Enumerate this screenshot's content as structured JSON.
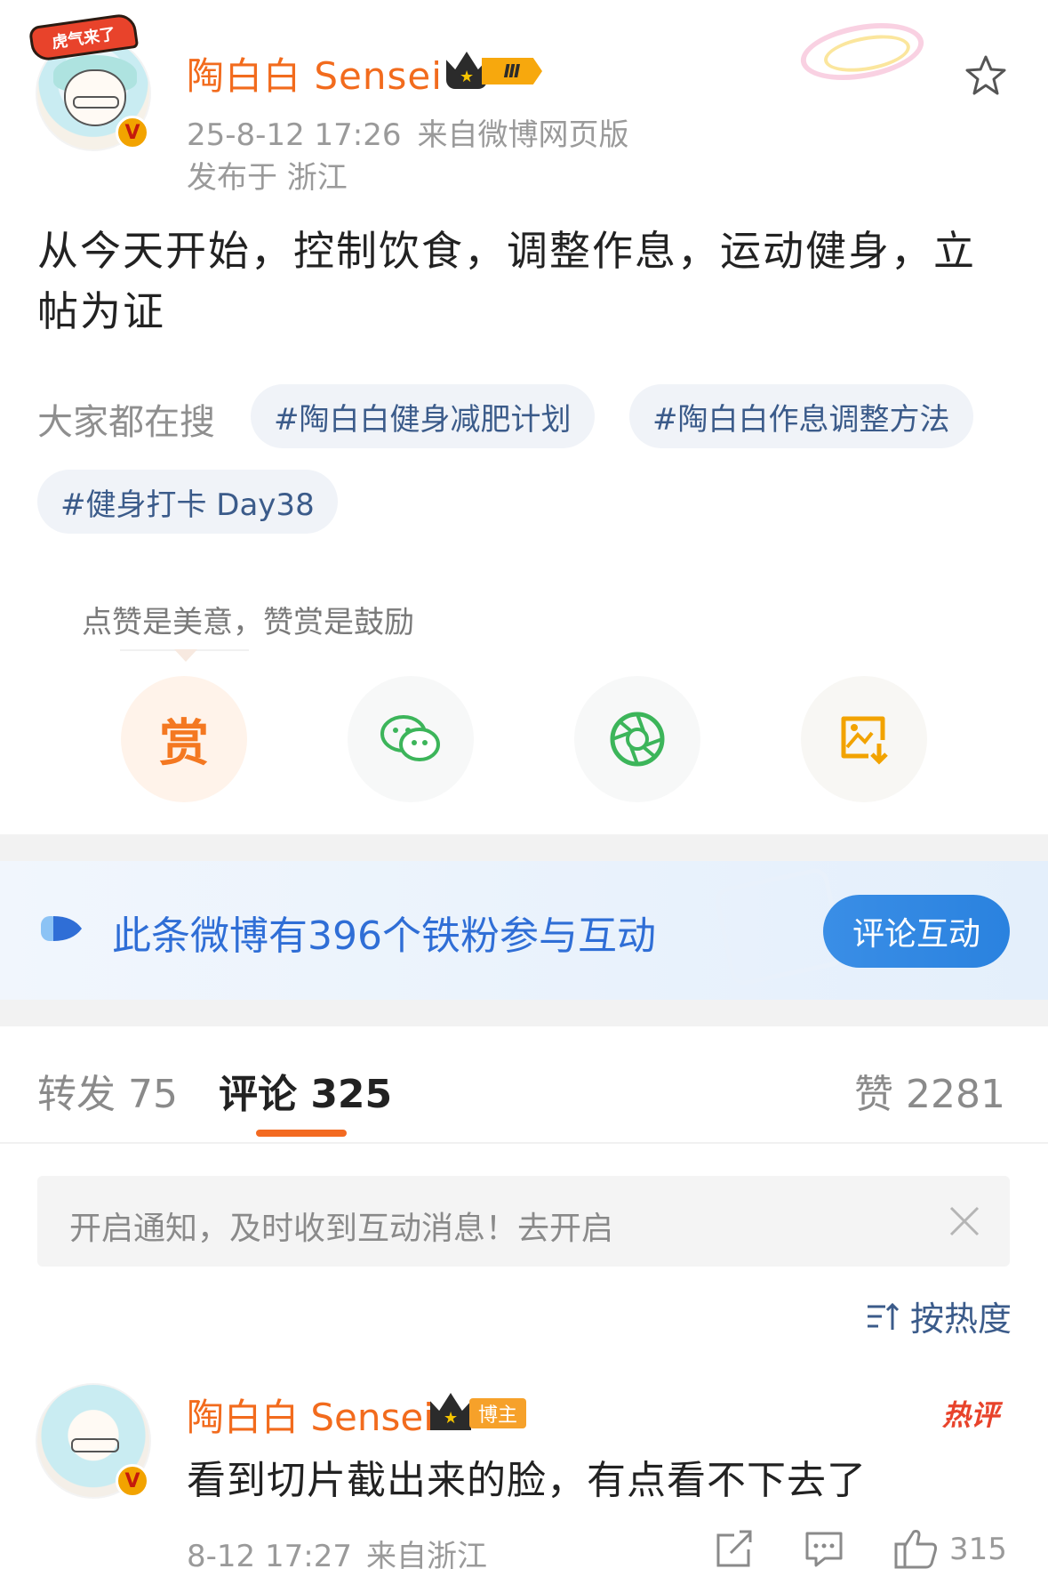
{
  "post": {
    "author_name": "陶白白 Sensei",
    "avatar_text": "虎气来了",
    "verified_mark": "V",
    "level_badge": "Ⅲ",
    "timestamp": "25-8-12 17:26",
    "source": "来自微博网页版",
    "location": "发布于 浙江",
    "text": "从今天开始，控制饮食，调整作息，运动健身，立帖为证"
  },
  "search": {
    "label": "大家都在搜",
    "tags": [
      "#陶白白健身减肥计划",
      "#陶白白作息调整方法",
      "#健身打卡 Day38"
    ]
  },
  "reward": {
    "tip": "点赞是美意，赞赏是鼓励",
    "reward_label": "赏",
    "icons": [
      "wechat-icon",
      "moments-icon",
      "save-image-icon"
    ]
  },
  "fan_banner": {
    "text": "此条微博有396个铁粉参与互动",
    "button_label": "评论互动"
  },
  "tabs": {
    "repost": "转发 75",
    "comment": "评论 325",
    "like": "赞 2281"
  },
  "notice": {
    "text": "开启通知，及时收到互动消息！去开启"
  },
  "sort": {
    "label": "按热度"
  },
  "comment": {
    "author_name": "陶白白 Sensei",
    "owner_badge": "博主",
    "hot_tag": "热评",
    "text": "看到切片截出来的脸，有点看不下去了",
    "timestamp": "8-12 17:27",
    "source": "来自浙江",
    "like_count": "315"
  },
  "colors": {
    "accent_orange": "#f26b1d",
    "link_blue": "#3b5b8a",
    "button_blue": "#2a82df",
    "wechat_green": "#3cb55a"
  }
}
